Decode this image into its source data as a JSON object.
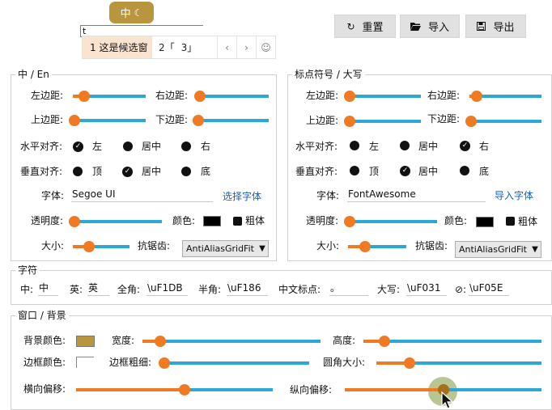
{
  "indicator": {
    "label": "中",
    "moon_icon": "☾"
  },
  "candidate": {
    "input_text": "t",
    "selected": "1 这是候选窗",
    "items": [
      "2「",
      "3」"
    ],
    "prev_icon": "‹",
    "next_icon": "›",
    "emoji_icon": "☺"
  },
  "toolbar": {
    "reset": "重置",
    "import": "导入",
    "export": "导出"
  },
  "chinese_panel": {
    "title": "中 / En",
    "left_margin": "左边距:",
    "right_margin": "右边距:",
    "top_margin": "上边距:",
    "bottom_margin": "下边距:",
    "h_align": "水平对齐:",
    "v_align": "垂直对齐:",
    "h_options": [
      "左",
      "居中",
      "右"
    ],
    "v_options": [
      "顶",
      "居中",
      "底"
    ],
    "font_label": "字体:",
    "font_value": "Segoe UI",
    "font_button": "选择字体",
    "opacity": "透明度:",
    "color": "颜色:",
    "bold": "粗体",
    "size": "大小:",
    "antialias": "抗锯齿:",
    "antialias_value": "AntiAliasGridFit",
    "values": {
      "left_margin": 0.15,
      "right_margin": 0.04,
      "top_margin": 0.02,
      "bottom_margin": 0.02,
      "opacity": 0.02,
      "size": 0.28
    }
  },
  "punct_panel": {
    "title": "标点符号 / 大写",
    "left_margin": "左边距:",
    "right_margin": "右边距:",
    "top_margin": "上边距:",
    "bottom_margin": "下边距:",
    "h_align": "水平对齐:",
    "v_align": "垂直对齐:",
    "h_options": [
      "左",
      "居中",
      "右"
    ],
    "v_options": [
      "顶",
      "居中",
      "底"
    ],
    "font_label": "字体:",
    "font_value": "FontAwesome",
    "font_button": "导入字体",
    "opacity": "透明度:",
    "color": "颜色:",
    "bold": "粗体",
    "size": "大小:",
    "antialias": "抗锯齿:",
    "antialias_value": "AntiAliasGridFit",
    "values": {
      "left_margin": 0.02,
      "right_margin": 0.1,
      "top_margin": 0.02,
      "bottom_margin": 0.02,
      "opacity": 0.02,
      "size": 0.29
    }
  },
  "chars": {
    "title": "字符",
    "zh_label": "中:",
    "zh_value": "中",
    "en_label": "英:",
    "en_value": "英",
    "full_label": "全角:",
    "full_value": "\\uF1DB",
    "half_label": "半角:",
    "half_value": "\\uF186",
    "punct_label": "中文标点:",
    "punct_value": "。",
    "caps_label": "大写:",
    "caps_value": "\\uF031",
    "off_label": "⊘:",
    "off_value": "\\uF05E"
  },
  "window": {
    "title": "窗口 / 背景",
    "bg_color": "背景颜色:",
    "width": "宽度:",
    "height": "高度:",
    "border_color": "边框颜色:",
    "border_width": "边框粗细:",
    "radius": "圆角大小:",
    "h_offset": "横向偏移:",
    "v_offset": "纵向偏移:",
    "bg_swatch": "#b9963e",
    "values": {
      "width": 0.1,
      "height": 0.12,
      "border_width": 0.02,
      "radius": 0.2,
      "h_offset": 0.55,
      "v_offset": 0.5
    }
  },
  "colors": {
    "accent_orange": "#f07a22",
    "track_blue": "#2ba8d8",
    "gold": "#b9963e"
  }
}
